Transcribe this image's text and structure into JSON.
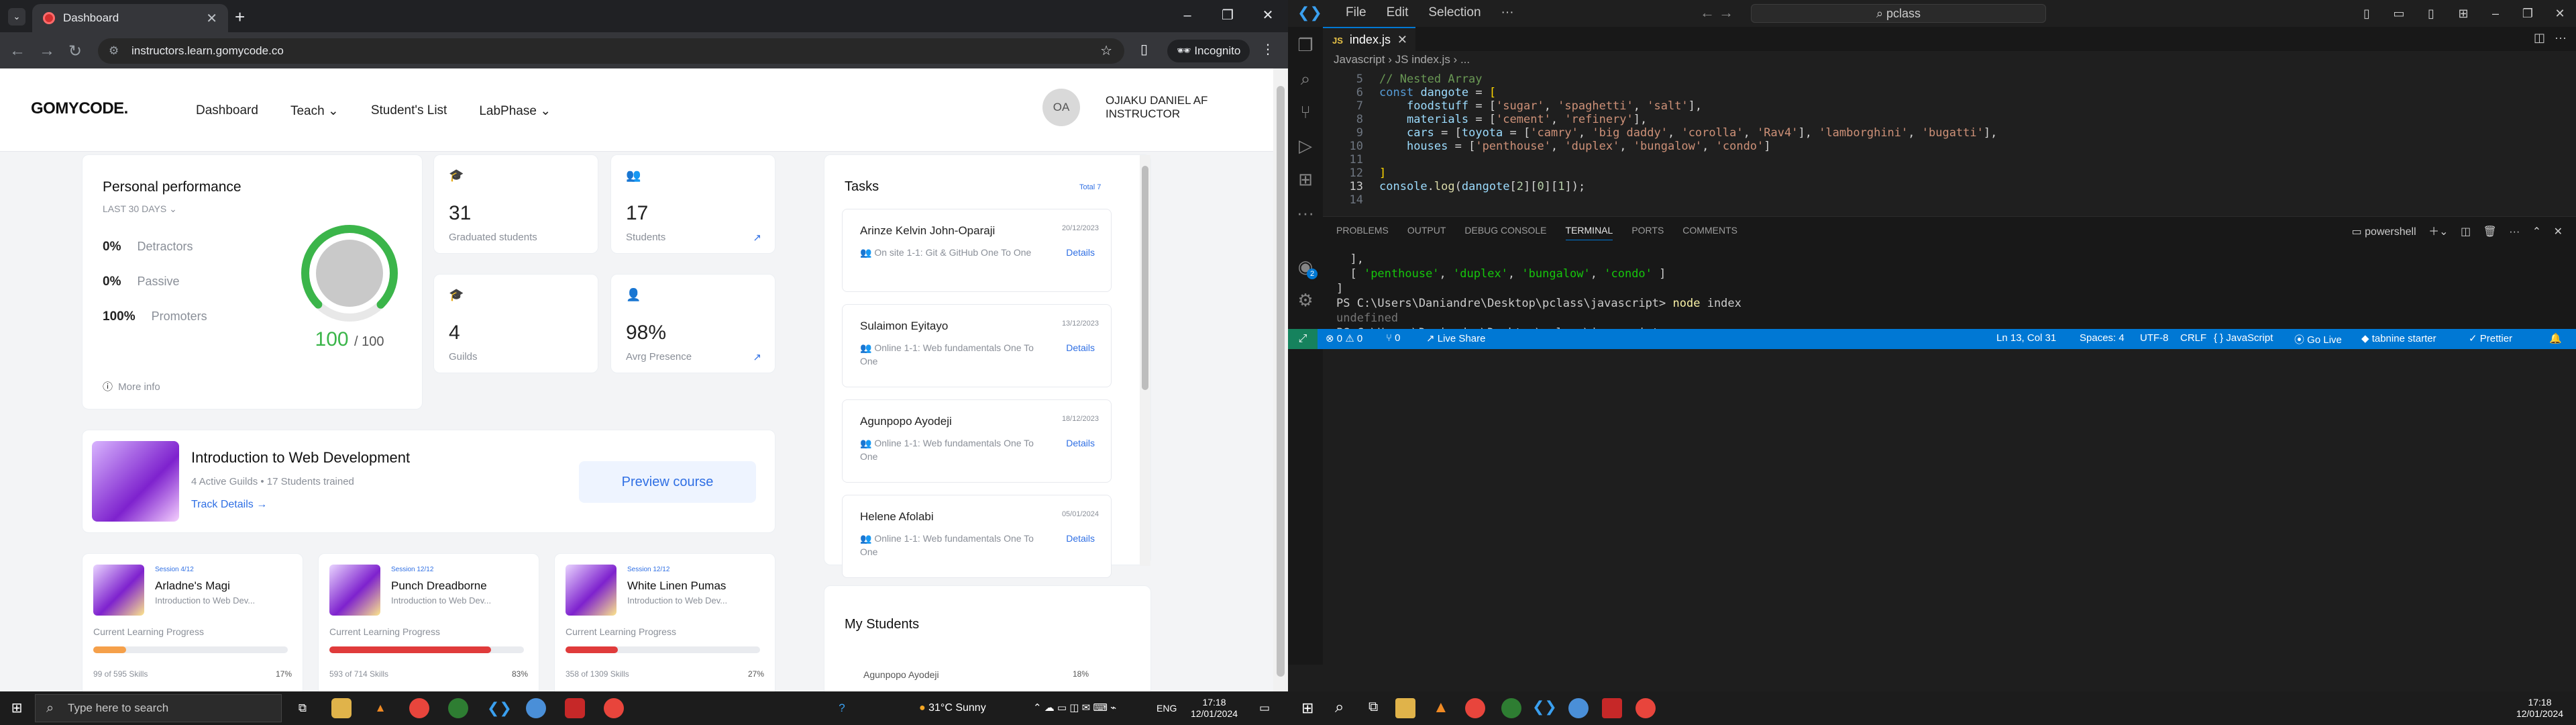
{
  "browser": {
    "tab_title": "Dashboard",
    "url": "instructors.learn.gomycode.co",
    "incognito_label": "Incognito"
  },
  "site": {
    "logo": "GOMYCODE.",
    "nav": [
      "Dashboard",
      "Teach ⌄",
      "Student's List",
      "LabPhase ⌄"
    ],
    "user_initials": "OA",
    "user_name": "OJIAKU DANIEL AF",
    "user_role": "INSTRUCTOR"
  },
  "performance": {
    "title": "Personal performance",
    "period": "LAST 30 DAYS ⌄",
    "rows": [
      {
        "pct": "0%",
        "label": "Detractors"
      },
      {
        "pct": "0%",
        "label": "Passive"
      },
      {
        "pct": "100%",
        "label": "Promoters"
      }
    ],
    "score": "100",
    "score_max": "/ 100",
    "score_value": 100,
    "more_info": "More info"
  },
  "stats": [
    {
      "value": "31",
      "label": "Graduated students"
    },
    {
      "value": "17",
      "label": "Students"
    },
    {
      "value": "4",
      "label": "Guilds"
    },
    {
      "value": "98%",
      "label": "Avrg Presence"
    }
  ],
  "course": {
    "title": "Introduction to Web Development",
    "meta": "4 Active Guilds • 17 Students trained",
    "track": "Track Details →",
    "preview": "Preview course"
  },
  "sessions": [
    {
      "tag": "Session 4/12",
      "name": "Arladne's Magi",
      "desc": "Introduction to Web Dev...",
      "progress_label": "Current Learning Progress",
      "skills": "99 of 595 Skills",
      "pct": "17%",
      "progress": 0.17,
      "color": "#f5a04a"
    },
    {
      "tag": "Session 12/12",
      "name": "Punch Dreadborne",
      "desc": "Introduction to Web Dev...",
      "progress_label": "Current Learning Progress",
      "skills": "593 of 714 Skills",
      "pct": "83%",
      "progress": 0.83,
      "color": "#e03b3b"
    },
    {
      "tag": "Session 12/12",
      "name": "White Linen Pumas",
      "desc": "Introduction to Web Dev...",
      "progress_label": "Current Learning Progress",
      "skills": "358 of 1309 Skills",
      "pct": "27%",
      "progress": 0.27,
      "color": "#e03b3b"
    }
  ],
  "tasks": {
    "title": "Tasks",
    "total": "Total 7",
    "items": [
      {
        "name": "Arinze Kelvin John-Oparaji",
        "date": "20/12/2023",
        "desc": "On site 1-1: Git & GitHub One To One",
        "details": "Details"
      },
      {
        "name": "Sulaimon Eyitayo",
        "date": "13/12/2023",
        "desc": "Online 1-1: Web fundamentals One To One",
        "details": "Details"
      },
      {
        "name": "Agunpopo Ayodeji",
        "date": "18/12/2023",
        "desc": "Online 1-1: Web fundamentals One To One",
        "details": "Details"
      },
      {
        "name": "Helene Afolabi",
        "date": "05/01/2024",
        "desc": "Online 1-1: Web fundamentals One To One",
        "details": "Details"
      }
    ]
  },
  "my_students": {
    "title": "My Students",
    "first": "Agunpopo Ayodeji",
    "first_pct": "18%"
  },
  "taskbar_left": {
    "search_placeholder": "Type here to search",
    "weather": "31°C  Sunny",
    "lang": "ENG",
    "time": "17:18",
    "date": "12/01/2024"
  },
  "vscode": {
    "menu": [
      "File",
      "Edit",
      "Selection",
      "···"
    ],
    "search": "pclass",
    "tab": "index.js",
    "breadcrumb": "Javascript  ›  JS index.js  ›  ...",
    "panel_tabs": [
      "PROBLEMS",
      "OUTPUT",
      "DEBUG CONSOLE",
      "TERMINAL",
      "PORTS",
      "COMMENTS"
    ],
    "shell": "powershell",
    "status": {
      "errors": "⊗ 0 ⚠ 0",
      "ports": "⑂ 0",
      "liveshare": "Live Share",
      "position": "Ln 13, Col 31",
      "spaces": "Spaces: 4",
      "encoding": "UTF-8",
      "eol": "CRLF",
      "language": "{ } JavaScript",
      "golive": "Go Live",
      "tabnine": "tabnine starter",
      "prettier": "✓ Prettier"
    },
    "time": "17:18",
    "date": "12/01/2024",
    "accounts_badge": "2"
  }
}
